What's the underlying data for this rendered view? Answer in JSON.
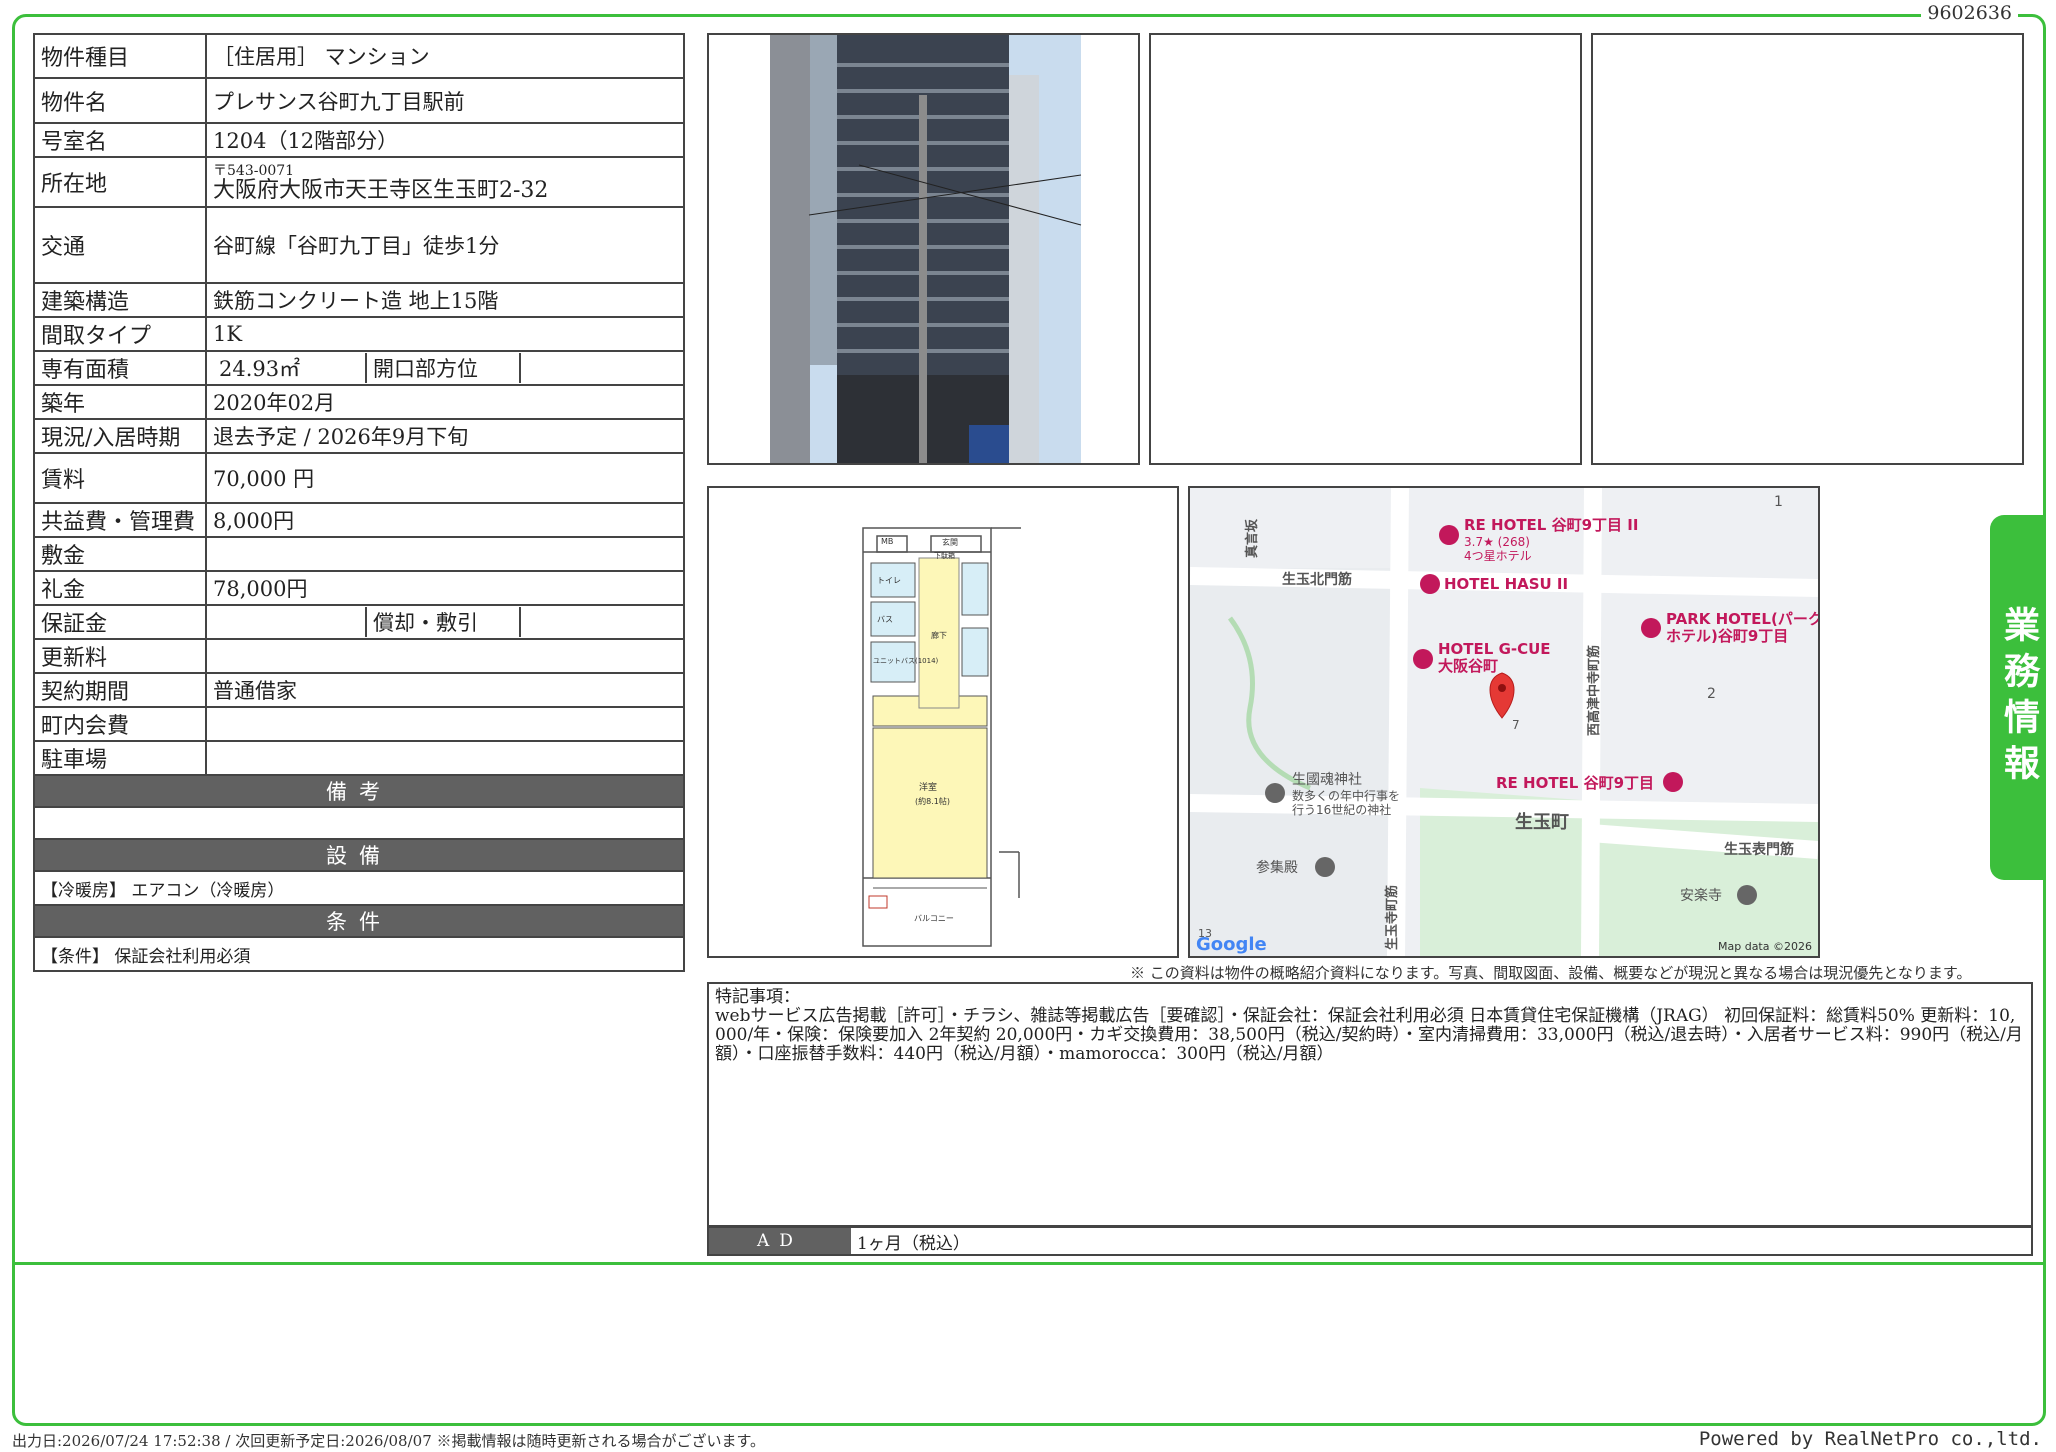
{
  "doc_id": "9602636",
  "side_tab": "業務情報",
  "property": {
    "type_label": "物件種目",
    "type_value": "［住居用］ マンション",
    "name_label": "物件名",
    "name_value": "プレサンス谷町九丁目駅前",
    "room_label": "号室名",
    "room_value": "1204（12階部分）",
    "address_label": "所在地",
    "postal": "〒543-0071",
    "address_value": "大阪府大阪市天王寺区生玉町2-32",
    "transit_label": "交通",
    "transit_value": "谷町線「谷町九丁目」徒歩1分",
    "structure_label": "建築構造",
    "structure_value": "鉄筋コンクリート造 地上15階",
    "layout_label": "間取タイプ",
    "layout_value": "1K",
    "area_label": "専有面積",
    "area_value": "24.93㎡",
    "opening_label": "開口部方位",
    "opening_value": "",
    "built_label": "築年",
    "built_value": "2020年02月",
    "status_label": "現況/入居時期",
    "status_value": "退去予定 / 2026年9月下旬",
    "rent_label": "賃料",
    "rent_value": "70,000 円",
    "fee_label": "共益費・管理費",
    "fee_value": "8,000円",
    "deposit_label": "敷金",
    "deposit_value": "",
    "key_money_label": "礼金",
    "key_money_value": "78,000円",
    "guarantee_label": "保証金",
    "guarantee_value": "",
    "amort_label": "償却・敷引",
    "amort_value": "",
    "renewal_label": "更新料",
    "renewal_value": "",
    "contract_label": "契約期間",
    "contract_value": "普通借家",
    "town_fee_label": "町内会費",
    "town_fee_value": "",
    "parking_label": "駐車場",
    "parking_value": ""
  },
  "sections": {
    "remarks_header": "備考",
    "remarks_value": "",
    "equipment_header": "設備",
    "equipment_value": "【冷暖房】 エアコン（冷暖房）",
    "conditions_header": "条件",
    "conditions_value": "【条件】 保証会社利用必須"
  },
  "floorplan": {
    "mb": "MB",
    "entrance": "玄関",
    "shoes": "下駄箱",
    "toilet": "トイレ",
    "bath": "バス",
    "unit_bath": "ユニットバス(1014)",
    "corridor": "廊下",
    "western_room": "洋室",
    "room_size": "(約8.1帖)",
    "balcony": "バルコニー"
  },
  "map": {
    "labels": [
      "RE HOTEL 谷町9丁目 II",
      "3.7★ (268)",
      "4つ星ホテル",
      "HOTEL HASU II",
      "PARK HOTEL(パーク",
      "ホテル)谷町9丁目",
      "HOTEL G-CUE",
      "大阪谷町",
      "生國魂神社",
      "数多くの年中行事を",
      "行う16世紀の神社",
      "RE HOTEL 谷町9丁目",
      "生玉町",
      "参集殿",
      "安楽寺",
      "生玉北門筋",
      "生玉表門筋",
      "生玉寺町筋",
      "西高津中寺町筋",
      "真言坂",
      "1",
      "2",
      "7",
      "13"
    ],
    "google": "Google",
    "attribution": "Map data ©2026"
  },
  "note": "※ この資料は物件の概略紹介資料になります。写真、間取図面、設備、概要などが現況と異なる場合は現況優先となります。",
  "special_notes": {
    "title": "特記事項：",
    "body": "webサービス広告掲載［許可］・チラシ、雑誌等掲載広告［要確認］・保証会社：保証会社利用必須 日本賃貸住宅保証機構（JRAG） 初回保証料：総賃料50% 更新料：10,000/年・保険：保険要加入 2年契約 20,000円・カギ交換費用：38,500円（税込/契約時）・室内清掃費用：33,000円（税込/退去時）・入居者サービス料：990円（税込/月額）・口座振替手数料：440円（税込/月額）・mamorocca：300円（税込/月額）"
  },
  "ad": {
    "label": "AD",
    "value": "1ヶ月（税込）"
  },
  "footer": {
    "left": "出力日:2026/07/24 17:52:38 / 次回更新予定日:2026/08/07 ※掲載情報は随時更新される場合がございます。",
    "right": "Powered by RealNetPro co.,ltd."
  }
}
